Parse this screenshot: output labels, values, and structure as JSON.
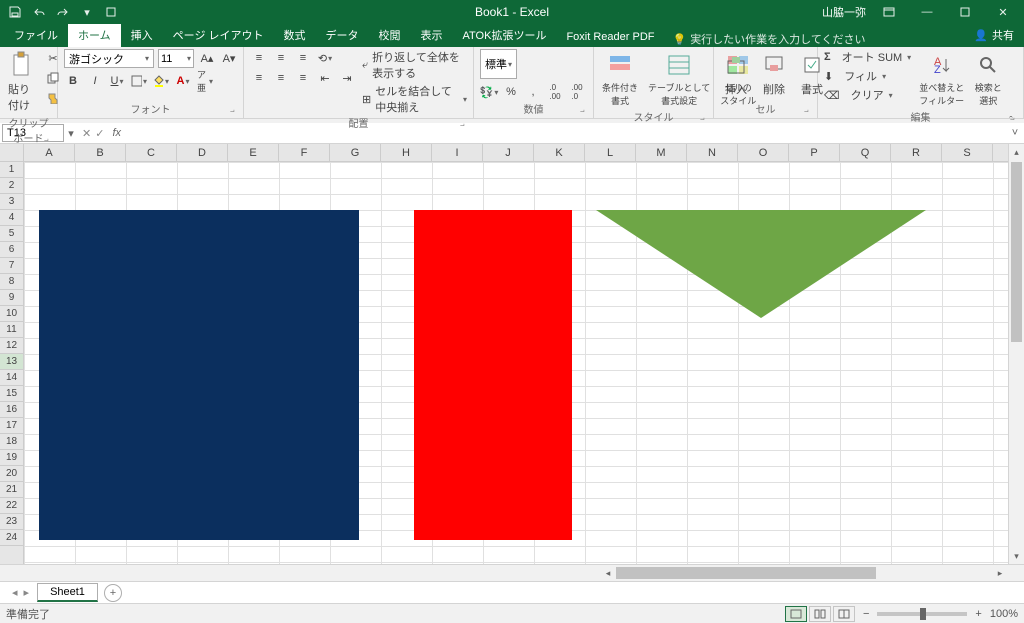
{
  "title": "Book1 - Excel",
  "user": "山脇一弥",
  "share": "共有",
  "tabs": {
    "file": "ファイル",
    "home": "ホーム",
    "insert": "挿入",
    "pagelayout": "ページ レイアウト",
    "formulas": "数式",
    "data": "データ",
    "review": "校閲",
    "view": "表示",
    "atok": "ATOK拡張ツール",
    "foxit": "Foxit Reader PDF"
  },
  "tellme": "実行したい作業を入力してください",
  "ribbon": {
    "clipboard": {
      "label": "クリップボード",
      "paste": "貼り付け"
    },
    "font": {
      "label": "フォント",
      "name": "游ゴシック",
      "size": "11"
    },
    "alignment": {
      "label": "配置",
      "wrap": "折り返して全体を表示する",
      "merge": "セルを結合して中央揃え"
    },
    "number": {
      "label": "数値",
      "format": "標準"
    },
    "styles": {
      "label": "スタイル",
      "cond": "条件付き\n書式",
      "table": "テーブルとして\n書式設定",
      "cell": "セルの\nスタイル"
    },
    "cells": {
      "label": "セル",
      "insert": "挿入",
      "delete": "削除",
      "format": "書式"
    },
    "editing": {
      "label": "編集",
      "autosum": "オート SUM",
      "fill": "フィル",
      "clear": "クリア",
      "sort": "並べ替えと\nフィルター",
      "find": "検索と\n選択"
    }
  },
  "namebox": "T13",
  "columns": [
    "A",
    "B",
    "C",
    "D",
    "E",
    "F",
    "G",
    "H",
    "I",
    "J",
    "K",
    "L",
    "M",
    "N",
    "O",
    "P",
    "Q",
    "R",
    "S"
  ],
  "rows": [
    "1",
    "2",
    "3",
    "4",
    "5",
    "6",
    "7",
    "8",
    "9",
    "10",
    "11",
    "12",
    "13",
    "14",
    "15",
    "16",
    "17",
    "18",
    "19",
    "20",
    "21",
    "22",
    "23",
    "24"
  ],
  "selected_row": 13,
  "shapes": {
    "rect1": {
      "fill": "#0b2f5e"
    },
    "rect2": {
      "fill": "#ff0000"
    },
    "tri": {
      "fill": "#6ea646"
    }
  },
  "sheet": "Sheet1",
  "status": "準備完了",
  "zoom": "100%"
}
